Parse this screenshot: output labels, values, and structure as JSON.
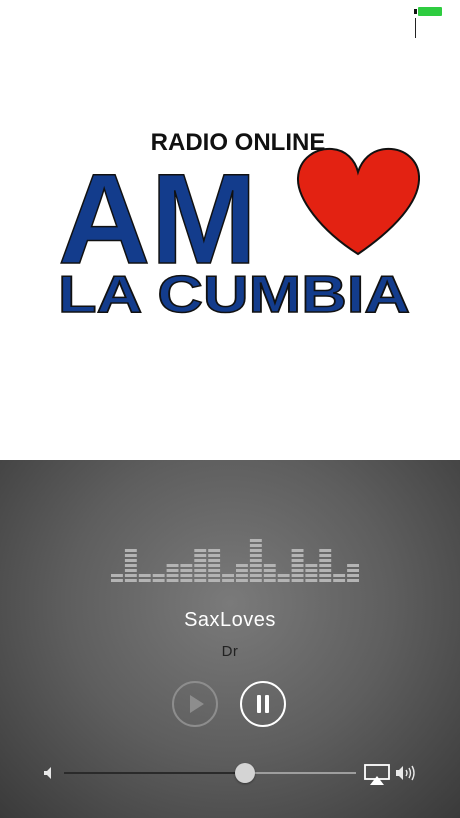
{
  "app": {
    "logo": {
      "top_text": "RADIO ONLINE",
      "main_text": "AM",
      "bottom_text": "LA CUMBIA"
    }
  },
  "status_bar": {
    "battery_color": "#2ecc40"
  },
  "player": {
    "track_title": "SaxLoves",
    "track_artist": "Dr",
    "volume_level": 0.62,
    "equalizer_levels": [
      1,
      3,
      1,
      1,
      2,
      2,
      3,
      3,
      1,
      2,
      4,
      2,
      1,
      3,
      2,
      3,
      1,
      2
    ],
    "colors": {
      "heart": "#e32212",
      "logo_blue": "#133c8c",
      "eq": "#b4b4b4"
    },
    "icons": {
      "play": "play-icon",
      "pause": "pause-icon",
      "volume_low": "volume-low-icon",
      "volume_high": "volume-high-icon",
      "airplay": "airplay-icon"
    }
  }
}
